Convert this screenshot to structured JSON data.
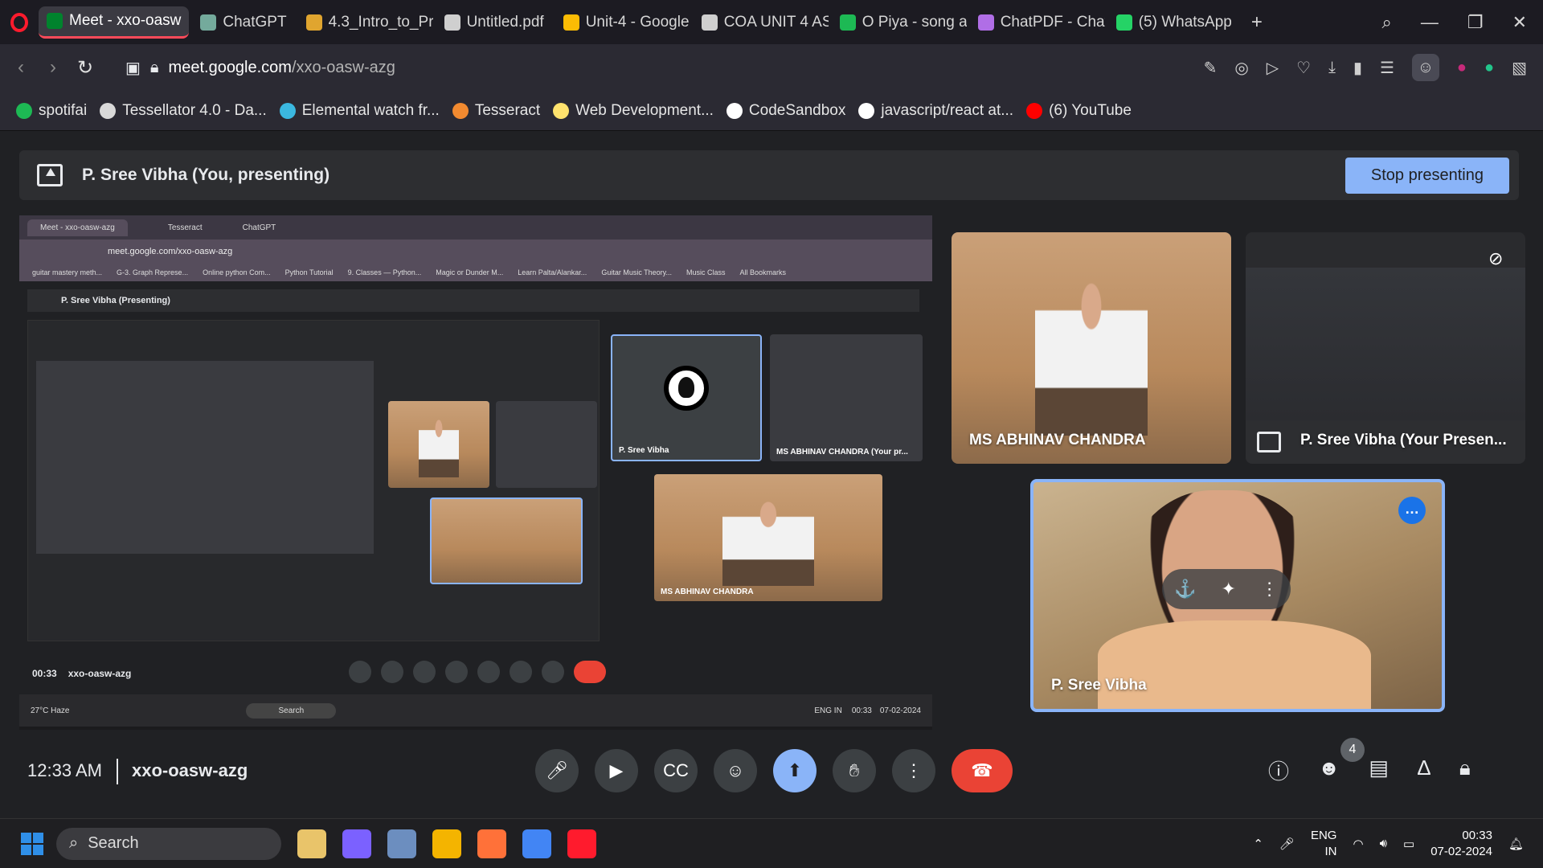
{
  "browser": {
    "tabs": [
      {
        "label": "Meet - xxo-oasw",
        "color": "#00832d",
        "active": true
      },
      {
        "label": "ChatGPT",
        "color": "#74aa9c"
      },
      {
        "label": "4.3_Intro_to_Pr",
        "color": "#e0a52f"
      },
      {
        "label": "Untitled.pdf",
        "color": "#cfcfcf"
      },
      {
        "label": "Unit-4 - Google",
        "color": "#fbbc04"
      },
      {
        "label": "COA UNIT 4 AS",
        "color": "#cfcfcf"
      },
      {
        "label": "O Piya - song a",
        "color": "#1db954"
      },
      {
        "label": "ChatPDF - Chat",
        "color": "#b06ee6"
      },
      {
        "label": "(5) WhatsApp",
        "color": "#25d366"
      }
    ],
    "new_tab": "+",
    "url_host": "meet.google.com",
    "url_path": "/xxo-oasw-azg",
    "bookmarks": [
      {
        "label": "spotifai",
        "color": "#1db954"
      },
      {
        "label": "Tessellator 4.0 - Da...",
        "color": "#d9d9d9"
      },
      {
        "label": "Elemental watch fr...",
        "color": "#3bb8e0"
      },
      {
        "label": "Tesseract",
        "color": "#f28a30"
      },
      {
        "label": "Web Development...",
        "color": "#ffe36e"
      },
      {
        "label": "CodeSandbox",
        "color": "#ffffff"
      },
      {
        "label": "javascript/react at...",
        "color": "#ffffff"
      },
      {
        "label": "(6) YouTube",
        "color": "#ff0000"
      }
    ]
  },
  "meet": {
    "presenting_banner": "P. Sree Vibha (You, presenting)",
    "stop_presenting": "Stop presenting",
    "tiles": {
      "abhinav": "MS ABHINAV CHANDRA",
      "sree_presentation": "P. Sree Vibha (Your Presen...",
      "sree": "P. Sree Vibha"
    },
    "time": "12:33 AM",
    "meeting_code": "xxo-oasw-azg",
    "participant_count": "4",
    "shared_screen": {
      "tabs": [
        "Meet - xxo-oasw-azg",
        "Tesseract",
        "ChatGPT"
      ],
      "url": "meet.google.com/xxo-oasw-azg",
      "bookmarks": [
        "guitar mastery meth...",
        "G-3. Graph Represe...",
        "Online python Com...",
        "Python Tutorial",
        "9. Classes — Python...",
        "Magic or Dunder M...",
        "Learn Palta/Alankar...",
        "Guitar Music Theory...",
        "Music Class",
        "All Bookmarks"
      ],
      "presenting_banner": "P. Sree Vibha (Presenting)",
      "tile_sree": "P. Sree Vibha",
      "tile_abhinav_present": "MS ABHINAV CHANDRA (Your pr...",
      "tile_abhinav": "MS ABHINAV CHANDRA",
      "time": "00:33",
      "meeting_code": "xxo-oasw-azg",
      "weather": "27°C Haze",
      "search": "Search",
      "lang": "ENG IN",
      "clock_time": "00:33",
      "clock_date": "07-02-2024"
    }
  },
  "taskbar": {
    "search": "Search",
    "lang_top": "ENG",
    "lang_bottom": "IN",
    "time": "00:33",
    "date": "07-02-2024",
    "apps": [
      "#e9c46a",
      "#7b61ff",
      "#6c8ebf",
      "#f4b400",
      "#ff7139",
      "#4285f4",
      "#ff1b2d"
    ]
  }
}
